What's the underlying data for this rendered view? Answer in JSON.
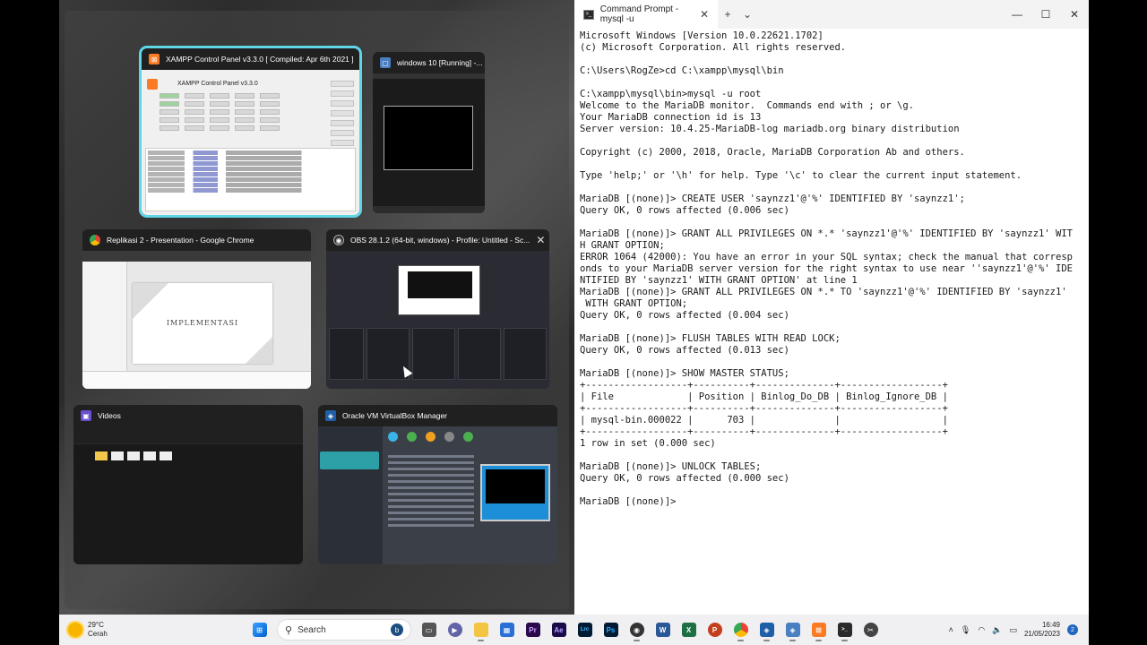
{
  "taskview": {
    "windows": [
      {
        "key": "xampp",
        "title": "XAMPP Control Panel v3.3.0   [ Compiled: Apr 6th 2021 ]",
        "preview_heading": "XAMPP Control Panel v3.3.0",
        "selected": true
      },
      {
        "key": "vm",
        "title": "windows 10 [Running] -..."
      },
      {
        "key": "chrome",
        "title": "Replikasi 2 - Presentation - Google Chrome",
        "slide_title": "IMPLEMENTASI"
      },
      {
        "key": "obs",
        "title": "OBS 28.1.2 (64-bit, windows) - Profile: Untitled - Sc..."
      },
      {
        "key": "videos",
        "title": "Videos"
      },
      {
        "key": "vbox",
        "title": "Oracle VM VirtualBox Manager"
      }
    ],
    "close_glyph": "✕"
  },
  "terminal": {
    "tab_title": "Command Prompt - mysql -u",
    "tab_close": "✕",
    "add_tab": "+",
    "dropdown": "⌄",
    "minimize": "—",
    "maximize": "☐",
    "close": "✕",
    "content": "Microsoft Windows [Version 10.0.22621.1702]\n(c) Microsoft Corporation. All rights reserved.\n\nC:\\Users\\RogZe>cd C:\\xampp\\mysql\\bin\n\nC:\\xampp\\mysql\\bin>mysql -u root\nWelcome to the MariaDB monitor.  Commands end with ; or \\g.\nYour MariaDB connection id is 13\nServer version: 10.4.25-MariaDB-log mariadb.org binary distribution\n\nCopyright (c) 2000, 2018, Oracle, MariaDB Corporation Ab and others.\n\nType 'help;' or '\\h' for help. Type '\\c' to clear the current input statement.\n\nMariaDB [(none)]> CREATE USER 'saynzz1'@'%' IDENTIFIED BY 'saynzz1';\nQuery OK, 0 rows affected (0.006 sec)\n\nMariaDB [(none)]> GRANT ALL PRIVILEGES ON *.* 'saynzz1'@'%' IDENTIFIED BY 'saynzz1' WIT\nH GRANT OPTION;\nERROR 1064 (42000): You have an error in your SQL syntax; check the manual that corresp\nonds to your MariaDB server version for the right syntax to use near ''saynzz1'@'%' IDE\nNTIFIED BY 'saynzz1' WITH GRANT OPTION' at line 1\nMariaDB [(none)]> GRANT ALL PRIVILEGES ON *.* TO 'saynzz1'@'%' IDENTIFIED BY 'saynzz1'\n WITH GRANT OPTION;\nQuery OK, 0 rows affected (0.004 sec)\n\nMariaDB [(none)]> FLUSH TABLES WITH READ LOCK;\nQuery OK, 0 rows affected (0.013 sec)\n\nMariaDB [(none)]> SHOW MASTER STATUS;\n+------------------+----------+--------------+------------------+\n| File             | Position | Binlog_Do_DB | Binlog_Ignore_DB |\n+------------------+----------+--------------+------------------+\n| mysql-bin.000022 |      703 |              |                  |\n+------------------+----------+--------------+------------------+\n1 row in set (0.000 sec)\n\nMariaDB [(none)]> UNLOCK TABLES;\nQuery OK, 0 rows affected (0.000 sec)\n\nMariaDB [(none)]>"
  },
  "taskbar": {
    "weather_temp": "29°C",
    "weather_desc": "Cerah",
    "search_label": "Search",
    "apps": [
      "start",
      "search",
      "task-view",
      "teams",
      "file-explorer",
      "store",
      "premiere",
      "after-effects",
      "lightroom-classic",
      "photoshop",
      "obs",
      "word",
      "excel",
      "powerpoint",
      "chrome",
      "virtualbox",
      "virtualbox-vm",
      "xampp",
      "command-prompt",
      "snipping"
    ],
    "app_labels": {
      "premiere": "Pr",
      "after_effects": "Ae",
      "lightroom": "Lrc",
      "photoshop": "Ps",
      "word": "W",
      "excel": "X",
      "powerpoint": "P"
    },
    "time": "16:49",
    "date": "21/05/2023",
    "notification_count": "2"
  }
}
